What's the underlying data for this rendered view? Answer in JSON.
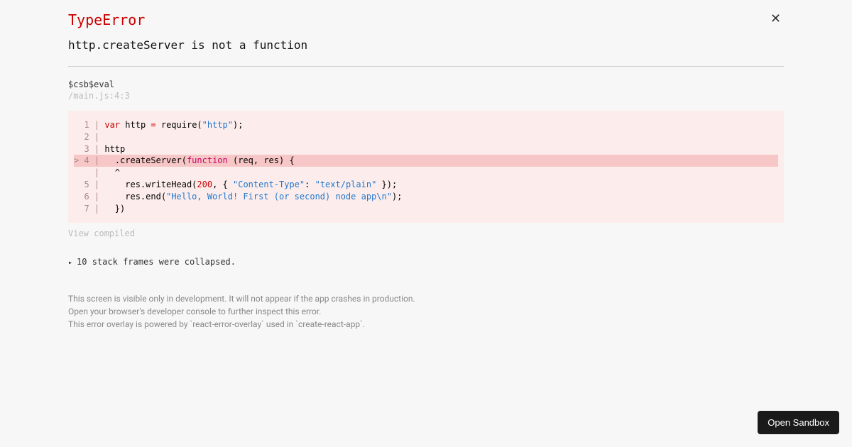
{
  "error": {
    "type": "TypeError",
    "message": "http.createServer is not a function"
  },
  "trace": {
    "origin": "$csb$eval",
    "location": "/main.js:4:3"
  },
  "code": {
    "lines": [
      {
        "num": "1",
        "prefix": "  ",
        "pipe": " | ",
        "seg": [
          {
            "t": "var ",
            "c": "kw"
          },
          {
            "t": "http ",
            "c": ""
          },
          {
            "t": "=",
            "c": "op"
          },
          {
            "t": " require(",
            "c": ""
          },
          {
            "t": "\"http\"",
            "c": "str"
          },
          {
            "t": ");",
            "c": ""
          }
        ]
      },
      {
        "num": "2",
        "prefix": "  ",
        "pipe": " | ",
        "seg": []
      },
      {
        "num": "3",
        "prefix": "  ",
        "pipe": " | ",
        "seg": [
          {
            "t": "http",
            "c": ""
          }
        ]
      },
      {
        "num": "4",
        "prefix": "> ",
        "pipe": " | ",
        "hl": true,
        "seg": [
          {
            "t": "  .createServer(",
            "c": ""
          },
          {
            "t": "function",
            "c": "fn"
          },
          {
            "t": " (req, res) {",
            "c": ""
          }
        ]
      },
      {
        "num": " ",
        "prefix": "  ",
        "pipe": " | ",
        "seg": [
          {
            "t": "  ^",
            "c": ""
          }
        ]
      },
      {
        "num": "5",
        "prefix": "  ",
        "pipe": " | ",
        "seg": [
          {
            "t": "    res.writeHead(",
            "c": ""
          },
          {
            "t": "200",
            "c": "num"
          },
          {
            "t": ", { ",
            "c": ""
          },
          {
            "t": "\"Content-Type\"",
            "c": "str"
          },
          {
            "t": ": ",
            "c": ""
          },
          {
            "t": "\"text/plain\"",
            "c": "str"
          },
          {
            "t": " });",
            "c": ""
          }
        ]
      },
      {
        "num": "6",
        "prefix": "  ",
        "pipe": " | ",
        "seg": [
          {
            "t": "    res.end(",
            "c": ""
          },
          {
            "t": "\"Hello, World! First (or second) node app\\n\"",
            "c": "str"
          },
          {
            "t": ");",
            "c": ""
          }
        ]
      },
      {
        "num": "7",
        "prefix": "  ",
        "pipe": " | ",
        "seg": [
          {
            "t": "  })",
            "c": ""
          }
        ]
      }
    ]
  },
  "view_compiled": "View compiled",
  "collapsed_frames": "10 stack frames were collapsed.",
  "footer": {
    "line1": "This screen is visible only in development. It will not appear if the app crashes in production.",
    "line2": "Open your browser's developer console to further inspect this error.",
    "line3": "This error overlay is powered by `react-error-overlay` used in `create-react-app`."
  },
  "open_sandbox": "Open Sandbox"
}
